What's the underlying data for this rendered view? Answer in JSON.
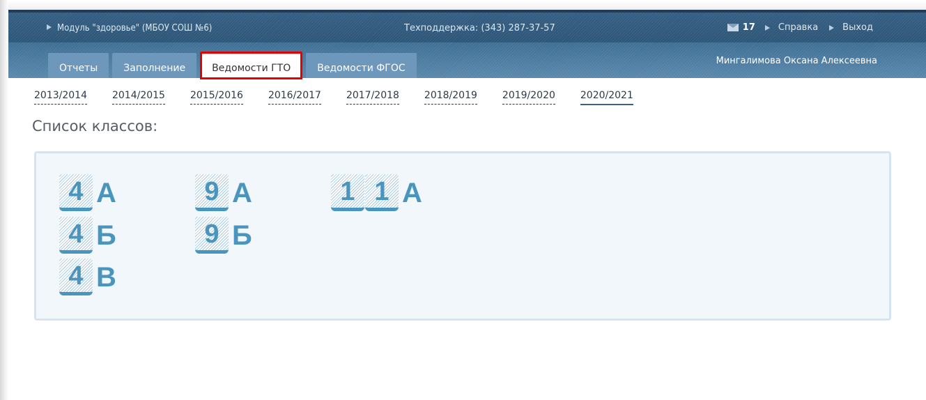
{
  "header": {
    "module": "Модуль \"здоровье\" (МБОУ СОШ №6)",
    "support": "Техподдержка: (343) 287-37-57",
    "mail_count": "17",
    "help_label": "Справка",
    "logout_label": "Выход",
    "user_name": "Мингалимова Оксана Алексеевна"
  },
  "tabs": [
    "Отчеты",
    "Заполнение",
    "Ведомости ГТО",
    "Ведомости ФГОС"
  ],
  "active_tab": "Ведомости ГТО",
  "years": [
    "2013/2014",
    "2014/2015",
    "2015/2016",
    "2016/2017",
    "2017/2018",
    "2018/2019",
    "2019/2020",
    "2020/2021"
  ],
  "active_year": "2020/2021",
  "classes_title": "Список классов:",
  "classes": [
    {
      "digits": [
        "4"
      ],
      "letter": "А"
    },
    {
      "digits": [
        "4"
      ],
      "letter": "Б"
    },
    {
      "digits": [
        "4"
      ],
      "letter": "В"
    },
    {
      "digits": [
        "9"
      ],
      "letter": "А"
    },
    {
      "digits": [
        "9"
      ],
      "letter": "Б"
    },
    {
      "digits": [
        "1",
        "1"
      ],
      "letter": "А"
    }
  ],
  "colors": {
    "header": "#2f5b7f",
    "tab": "#6e98bb",
    "active_highlight": "#e60000",
    "class_accent": "#4a95bd"
  }
}
